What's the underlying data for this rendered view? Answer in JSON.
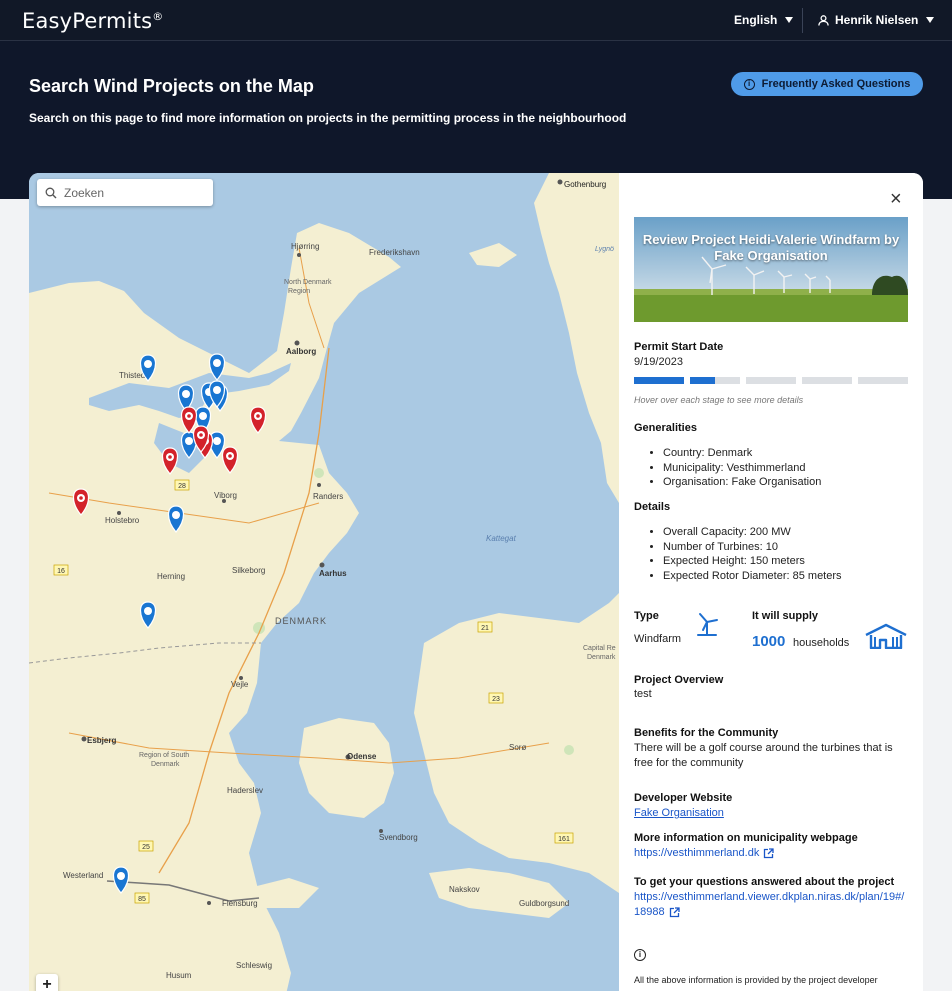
{
  "app": {
    "name": "EasyPermits",
    "registered": "®"
  },
  "header": {
    "language": "English",
    "user": "Henrik Nielsen"
  },
  "hero": {
    "title": "Search Wind Projects on the Map",
    "subtitle": "Search on this page to find more information on projects in the permitting process in the neighbourhood",
    "faq_label": "Frequently Asked Questions"
  },
  "map": {
    "search_placeholder": "Zoeken",
    "zoom_in": "+",
    "places": {
      "gothenburg": "Gothenburg",
      "hjorring": "Hjørring",
      "frederikshavn": "Frederikshavn",
      "north_region_1": "North Denmark",
      "north_region_2": "Region",
      "thisted": "Thisted",
      "aalborg": "Aalborg",
      "viborg": "Viborg",
      "randers": "Randers",
      "holstebro": "Holstebro",
      "herning": "Herning",
      "silkeborg": "Silkeborg",
      "aarhus": "Aarhus",
      "kattegat": "Kattegat",
      "denmark": "DENMARK",
      "vejle": "Vejle",
      "capital_1": "Capital Re",
      "capital_2": "Denmark",
      "esbjerg": "Esbjerg",
      "south_region_1": "Region of South",
      "south_region_2": "Denmark",
      "odense": "Odense",
      "soro": "Sorø",
      "haderslev": "Haderslev",
      "svendborg": "Svendborg",
      "westerland": "Westerland",
      "flensburg": "Flensburg",
      "nakskov": "Nakskov",
      "guldborgsund": "Guldborgsund",
      "husum": "Husum",
      "schleswig": "Schleswig",
      "lygno": "Lygnö"
    },
    "roads": [
      "28",
      "16",
      "21",
      "25",
      "85",
      "161",
      "23"
    ],
    "markers_blue": 12,
    "markers_red": 7
  },
  "project": {
    "banner_title": "Review Project Heidi-Valerie Windfarm by Fake Organisation",
    "permit_start_label": "Permit Start Date",
    "permit_start_value": "9/19/2023",
    "stages_progress": [
      1,
      0.5,
      0,
      0,
      0
    ],
    "stage_hint": "Hover over each stage to see more details",
    "generalities_label": "Generalities",
    "generalities": [
      "Country: Denmark",
      "Municipality: Vesthimmerland",
      "Organisation: Fake Organisation"
    ],
    "details_label": "Details",
    "details": [
      "Overall Capacity: 200 MW",
      "Number of Turbines: 10",
      "Expected Height: 150 meters",
      "Expected Rotor Diameter: 85 meters"
    ],
    "type_label": "Type",
    "type_value": "Windfarm",
    "supply_label": "It will supply",
    "supply_value": "1000",
    "supply_unit": "households",
    "overview_label": "Project Overview",
    "overview_value": "test",
    "benefits_label": "Benefits for the Community",
    "benefits_line1": "There will be a golf course around the turbines that is",
    "benefits_line2": "free for the community",
    "dev_site_label": "Developer Website",
    "dev_site_link": "Fake Organisation",
    "muni_label": "More information on municipality webpage",
    "muni_link": "https://vesthimmerland.dk",
    "questions_label": "To get your questions answered about the project",
    "questions_link_1": "https://vesthimmerland.viewer.dkplan.niras.dk/plan/19#/",
    "questions_link_2": "18988",
    "footer_note": "All the above information is provided by the project developer"
  },
  "colors": {
    "accent": "#1e6fd0",
    "marker_blue": "#1976d2",
    "marker_red": "#d3222a",
    "header_bg": "#111827"
  }
}
